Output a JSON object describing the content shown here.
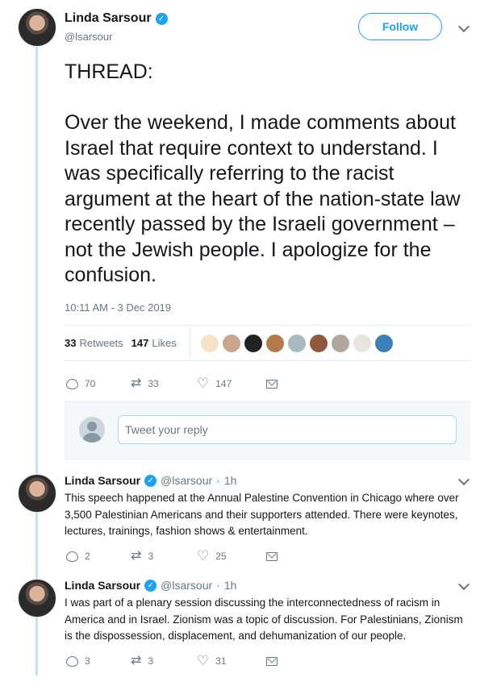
{
  "main_tweet": {
    "name": "Linda Sarsour",
    "handle": "@lsarsour",
    "follow_label": "Follow",
    "text": "THREAD:\n\nOver the weekend, I made comments about Israel that require context to understand. I was specifically referring to the racist argument at the heart of the nation-state law recently passed by the Israeli government – not the Jewish people. I apologize for the confusion.",
    "timestamp": "10:11 AM - 3 Dec 2019",
    "retweets_count": "33",
    "retweets_label": "Retweets",
    "likes_count": "147",
    "likes_label": "Likes",
    "actions": {
      "replies": "70",
      "retweets": "33",
      "likes": "147"
    }
  },
  "reply_box": {
    "placeholder": "Tweet your reply"
  },
  "replies": [
    {
      "name": "Linda Sarsour",
      "handle": "@lsarsour",
      "dot": "·",
      "time": "1h",
      "text": "This speech happened at the Annual Palestine Convention in Chicago where over 3,500 Palestinian Americans and their supporters attended. There were keynotes, lectures, trainings, fashion shows & entertainment.",
      "actions": {
        "replies": "2",
        "retweets": "3",
        "likes": "25"
      }
    },
    {
      "name": "Linda Sarsour",
      "handle": "@lsarsour",
      "dot": "·",
      "time": "1h",
      "text": "I was part of a plenary session discussing the interconnectedness of racism in America and in Israel. Zionism was a topic of discussion. For Palestinians, Zionism is the dispossession, displacement, and dehumanization of our people.",
      "actions": {
        "replies": "3",
        "retweets": "3",
        "likes": "31"
      }
    }
  ],
  "icons": {
    "verified": "verified-badge-icon",
    "reply": "reply-icon",
    "retweet": "retweet-icon",
    "like": "heart-icon",
    "message": "mail-icon",
    "menu": "chevron-down-icon"
  },
  "colors": {
    "accent": "#1da1f2",
    "secondary_text": "#657786",
    "thread_line": "#c4e3f5"
  }
}
